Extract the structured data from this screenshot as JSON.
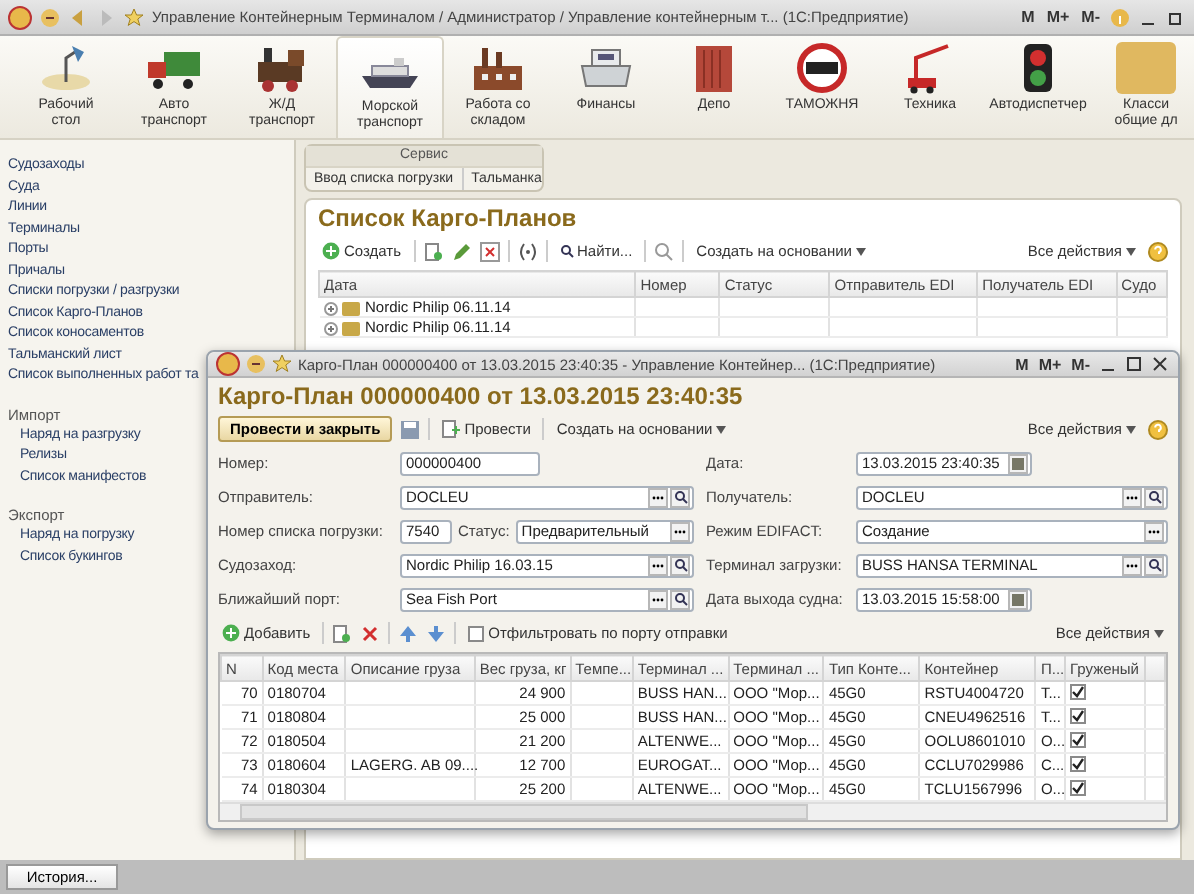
{
  "main_window": {
    "title": "Управление Контейнерным Терминалом / Администратор / Управление контейнерным т... (1С:Предприятие)",
    "title_buttons": [
      "M",
      "M+",
      "M-"
    ]
  },
  "sections": [
    {
      "label": "Рабочий\nстол",
      "selected": false
    },
    {
      "label": "Авто\nтранспорт",
      "selected": false
    },
    {
      "label": "Ж/Д\nтранспорт",
      "selected": false
    },
    {
      "label": "Морской\nтранспорт",
      "selected": true
    },
    {
      "label": "Работа со\nскладом",
      "selected": false
    },
    {
      "label": "Финансы",
      "selected": false
    },
    {
      "label": "Депо",
      "selected": false
    },
    {
      "label": "ТАМОЖНЯ",
      "selected": false
    },
    {
      "label": "Техника",
      "selected": false
    },
    {
      "label": "Автодиспетчер",
      "selected": false
    },
    {
      "label": "Класси\nобщие дл",
      "selected": false
    }
  ],
  "sidebar": {
    "items": [
      "Судозаходы",
      "Суда",
      "Линии",
      "Терминалы",
      "Порты",
      "Причалы",
      "Списки погрузки / разгрузки",
      "Список Карго-Планов",
      "Список коносаментов",
      "Тальманский лист",
      "Список выполненных работ та"
    ],
    "groups": [
      {
        "title": "Импорт",
        "items": [
          "Наряд на разгрузку",
          "Релизы",
          "Список манифестов"
        ]
      },
      {
        "title": "Экспорт",
        "items": [
          "Наряд на погрузку",
          "Список букингов"
        ]
      }
    ]
  },
  "service_panel": {
    "title": "Сервис",
    "links": [
      "Ввод списка погрузки",
      "Тальманка"
    ]
  },
  "cargo_plan_list": {
    "title": "Список Карго-Планов",
    "toolbar": {
      "create": "Создать",
      "find": "Найти...",
      "create_based": "Создать на основании",
      "all_actions": "Все действия"
    },
    "columns": [
      "Дата",
      "Номер",
      "Статус",
      "Отправитель EDI",
      "Получатель EDI",
      "Судо"
    ],
    "rows": [
      {
        "date": "Nordic Philip 06.11.14",
        "expanded": false
      },
      {
        "date": "Nordic Philip 06.11.14",
        "expanded": false
      }
    ]
  },
  "dialog": {
    "title": "Карго-План 000000400 от 13.03.2015 23:40:35 - Управление Контейнер... (1С:Предприятие)",
    "title_buttons": [
      "M",
      "M+",
      "M-"
    ],
    "heading": "Карго-План 000000400 от 13.03.2015 23:40:35",
    "toolbar": {
      "post_close": "Провести и закрыть",
      "post": "Провести",
      "create_based": "Создать на основании",
      "all_actions": "Все действия"
    },
    "field_rows": [
      {
        "left": [
          {
            "label": "Номер:",
            "value": "000000400",
            "kind": "plain"
          }
        ],
        "right": {
          "label": "Дата:",
          "value": "13.03.2015 23:40:35",
          "kind": "date"
        }
      },
      {
        "left": [
          {
            "label": "Отправитель:",
            "value": "DOCLEU",
            "kind": "ref"
          }
        ],
        "right": {
          "label": "Получатель:",
          "value": "DOCLEU",
          "kind": "ref"
        }
      },
      {
        "left": [
          {
            "label": "Номер списка погрузки:",
            "value": "7540",
            "kind": "plain"
          },
          {
            "label": "Статус:",
            "value": "Предварительный",
            "kind": "choice"
          }
        ],
        "right": {
          "label": "Режим EDIFACT:",
          "value": "Создание",
          "kind": "choice"
        }
      },
      {
        "left": [
          {
            "label": "Судозаход:",
            "value": "Nordic Philip 16.03.15",
            "kind": "ref"
          }
        ],
        "right": {
          "label": "Терминал загрузки:",
          "value": "BUSS HANSA TERMINAL",
          "kind": "ref"
        }
      },
      {
        "left": [
          {
            "label": "Ближайший порт:",
            "value": "Sea Fish Port",
            "kind": "ref"
          }
        ],
        "right": {
          "label": "Дата выхода судна:",
          "value": "13.03.2015 15:58:00",
          "kind": "date"
        }
      }
    ],
    "table_toolbar": {
      "add": "Добавить",
      "filter": {
        "label": "Отфильтровать по порту отправки",
        "checked": false
      },
      "all_actions": "Все действия"
    },
    "table": {
      "columns": [
        "N",
        "Код места",
        "Описание груза",
        "Вес груза, кг",
        "Темпе...",
        "Терминал ...",
        "Терминал ...",
        "Тип Конте...",
        "Контейнер",
        "П...",
        "Груженый"
      ],
      "rows": [
        {
          "cells": [
            "70",
            "0180704",
            "",
            "24 900",
            "",
            "BUSS HAN...",
            "ООО \"Мор...",
            "45G0",
            "RSTU4004720",
            "Т..."
          ],
          "loaded": true
        },
        {
          "cells": [
            "71",
            "0180804",
            "",
            "25 000",
            "",
            "BUSS HAN...",
            "ООО \"Мор...",
            "45G0",
            "CNEU4962516",
            "Т..."
          ],
          "loaded": true
        },
        {
          "cells": [
            "72",
            "0180504",
            "",
            "21 200",
            "",
            "ALTENWE...",
            "ООО \"Мор...",
            "45G0",
            "OOLU8601010",
            "О..."
          ],
          "loaded": true
        },
        {
          "cells": [
            "73",
            "0180604",
            "LAGERG. AB 09....",
            "12 700",
            "",
            "EUROGAT...",
            "ООО \"Мор...",
            "45G0",
            "CCLU7029986",
            "С..."
          ],
          "loaded": true
        },
        {
          "cells": [
            "74",
            "0180304",
            "",
            "25 200",
            "",
            "ALTENWE...",
            "ООО \"Мор...",
            "45G0",
            "TCLU1567996",
            "О..."
          ],
          "loaded": true
        }
      ]
    }
  },
  "history_button": "История..."
}
